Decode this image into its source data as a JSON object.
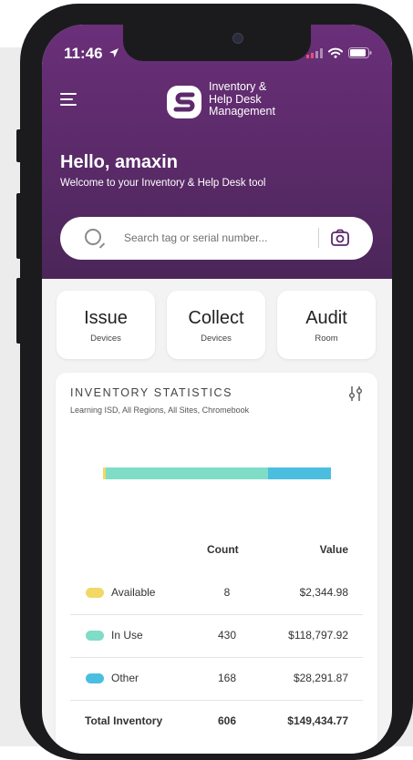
{
  "status_bar": {
    "time": "11:46"
  },
  "header": {
    "brand_line1": "Inventory &",
    "brand_line2": "Help Desk",
    "brand_line3": "Management",
    "greeting": "Hello, amaxin",
    "subtitle": "Welcome to your Inventory & Help Desk tool"
  },
  "search": {
    "placeholder": "Search tag or serial number..."
  },
  "actions": [
    {
      "title": "Issue",
      "sub": "Devices"
    },
    {
      "title": "Collect",
      "sub": "Devices"
    },
    {
      "title": "Audit",
      "sub": "Room"
    }
  ],
  "stats": {
    "title": "INVENTORY STATISTICS",
    "filter": "Learning ISD, All Regions, All Sites, Chromebook",
    "col_count": "Count",
    "col_value": "Value",
    "rows": [
      {
        "label": "Available",
        "count": "8",
        "value": "$2,344.98"
      },
      {
        "label": "In Use",
        "count": "430",
        "value": "$118,797.92"
      },
      {
        "label": "Other",
        "count": "168",
        "value": "$28,291.87"
      }
    ],
    "total": {
      "label": "Total Inventory",
      "count": "606",
      "value": "$149,434.77"
    }
  },
  "colors": {
    "brand_purple": "#5c2a6b",
    "available": "#f2d865",
    "in_use": "#7fdcc6",
    "other": "#4bbee0"
  }
}
